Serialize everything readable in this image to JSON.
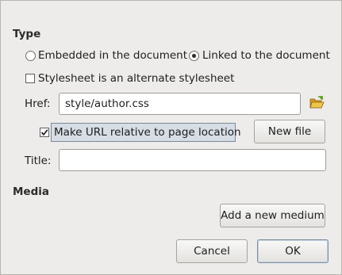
{
  "type_section": {
    "title": "Type",
    "radio_embedded": {
      "label": "Embedded in the document",
      "checked": false
    },
    "radio_linked": {
      "label": "Linked to the document",
      "checked": true
    },
    "alternate_checkbox": {
      "label": "Stylesheet is an alternate stylesheet",
      "checked": false
    },
    "href_label": "Href:",
    "href_value": "style/author.css",
    "browse_icon": "folder-open-icon",
    "relative_checkbox": {
      "label": "Make URL relative to page location",
      "checked": true
    },
    "new_file_label": "New file",
    "title_label": "Title:",
    "title_value": ""
  },
  "media_section": {
    "title": "Media",
    "add_medium_label": "Add a new medium"
  },
  "footer": {
    "cancel_label": "Cancel",
    "ok_label": "OK"
  },
  "colors": {
    "dialog_bg": "#edeceb",
    "focus_highlight": "#d6dde5",
    "folder_icon": "#e8b33a"
  }
}
